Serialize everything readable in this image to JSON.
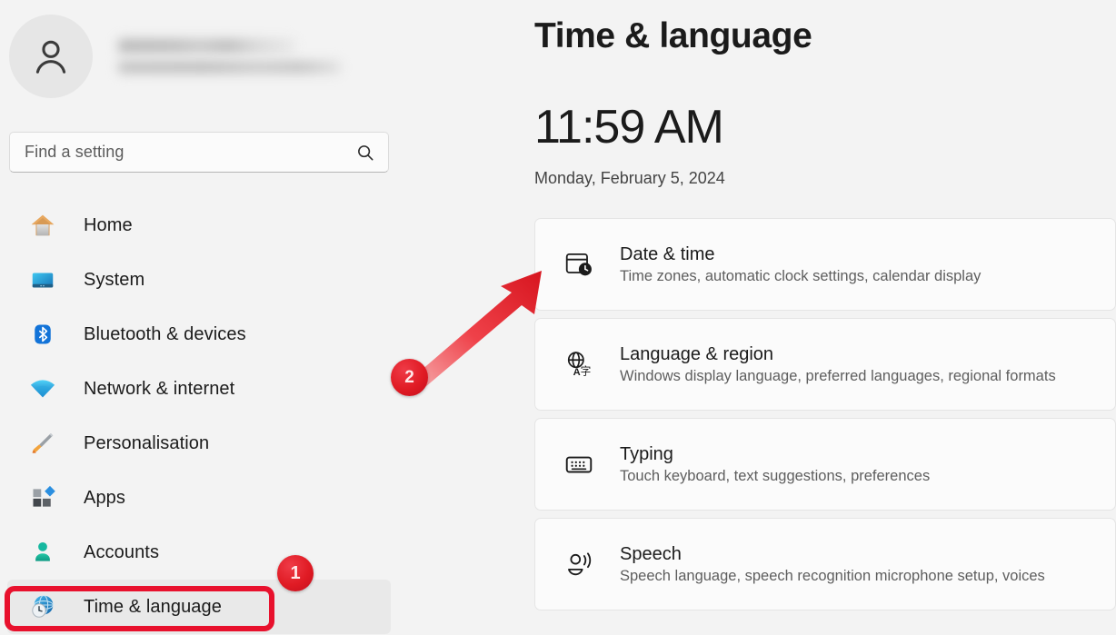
{
  "account": {
    "avatar_icon": "person-icon",
    "name_redacted": true,
    "email_redacted": true
  },
  "search": {
    "placeholder": "Find a setting",
    "icon": "search-icon"
  },
  "sidebar": {
    "items": [
      {
        "label": "Home",
        "icon": "home-icon",
        "selected": false
      },
      {
        "label": "System",
        "icon": "system-icon",
        "selected": false
      },
      {
        "label": "Bluetooth & devices",
        "icon": "bluetooth-icon",
        "selected": false
      },
      {
        "label": "Network & internet",
        "icon": "network-icon",
        "selected": false
      },
      {
        "label": "Personalisation",
        "icon": "paintbrush-icon",
        "selected": false
      },
      {
        "label": "Apps",
        "icon": "apps-icon",
        "selected": false
      },
      {
        "label": "Accounts",
        "icon": "accounts-icon",
        "selected": false
      },
      {
        "label": "Time & language",
        "icon": "time-language-icon",
        "selected": true
      }
    ]
  },
  "main": {
    "title": "Time & language",
    "clock": "11:59 AM",
    "date": "Monday, February 5, 2024",
    "cards": [
      {
        "title": "Date & time",
        "subtitle": "Time zones, automatic clock settings, calendar display",
        "icon": "calendar-clock-icon"
      },
      {
        "title": "Language & region",
        "subtitle": "Windows display language, preferred languages, regional formats",
        "icon": "globe-translate-icon"
      },
      {
        "title": "Typing",
        "subtitle": "Touch keyboard, text suggestions, preferences",
        "icon": "keyboard-icon"
      },
      {
        "title": "Speech",
        "subtitle": "Speech language, speech recognition microphone setup, voices",
        "icon": "speech-icon"
      }
    ]
  },
  "annotations": {
    "color": "#e8112d",
    "badge_1": "1",
    "badge_2": "2",
    "highlight_target": "Time & language",
    "arrow_target": "Date & time"
  }
}
